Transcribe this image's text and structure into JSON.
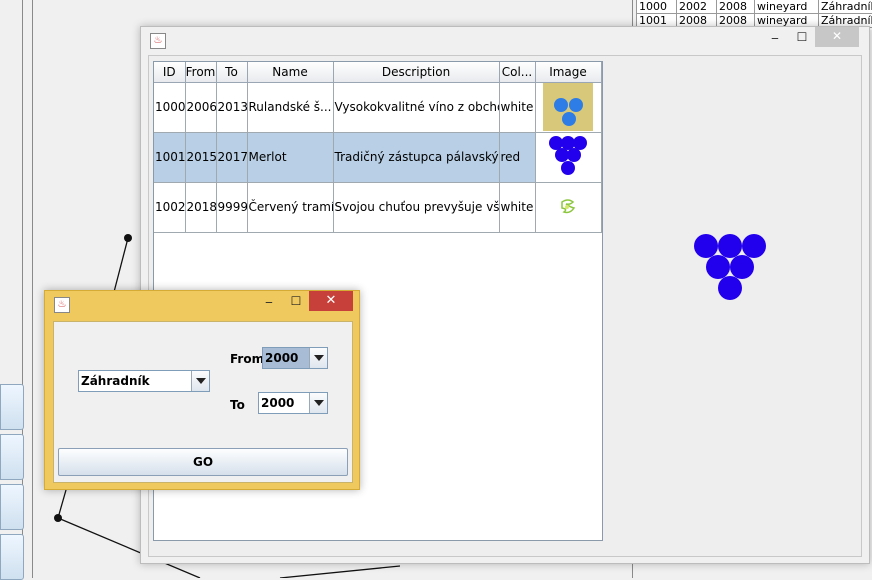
{
  "background_table": {
    "rows": [
      [
        "1000",
        "2002",
        "2008",
        "wineyard",
        "Záhradník"
      ],
      [
        "1001",
        "2008",
        "2008",
        "wineyard",
        "Záhradník"
      ]
    ]
  },
  "main_window": {
    "icon": "java-icon",
    "controls": {
      "minimize": "‒",
      "maximize": "☐",
      "close": "✕"
    }
  },
  "table": {
    "columns": [
      "ID",
      "From",
      "To",
      "Name",
      "Description",
      "Col...",
      "Image"
    ],
    "rows": [
      {
        "id": "1000",
        "from": "2006",
        "to": "2013",
        "name": "Rulandské š...",
        "description": "Vysokokvalitné víno z obcho...",
        "color": "white",
        "image": "grape-berries-icon"
      },
      {
        "id": "1001",
        "from": "2015",
        "to": "2017",
        "name": "Merlot",
        "description": "Tradičný zástupca pálavskýc...",
        "color": "red",
        "image": "grape-cluster-icon"
      },
      {
        "id": "1002",
        "from": "2018",
        "to": "9999",
        "name": "Červený tramín",
        "description": "Svojou chuťou prevyšuje vš...",
        "color": "white",
        "image": "grape-leaf-icon"
      }
    ],
    "selected_row": 1
  },
  "preview": {
    "image": "grape-cluster-icon",
    "color": "#2200ee"
  },
  "filter_dialog": {
    "icon": "java-icon",
    "controls": {
      "minimize": "‒",
      "maximize": "☐",
      "close": "✕"
    },
    "owner_value": "Záhradník",
    "from_label": "From",
    "from_value": "2000",
    "to_label": "To",
    "to_value": "2000",
    "go_label": "GO"
  },
  "colors": {
    "selection": "#b8cfe5",
    "dialog_frame": "#efc95d",
    "close_red": "#c7403a",
    "grape_blue": "#2200ee"
  }
}
